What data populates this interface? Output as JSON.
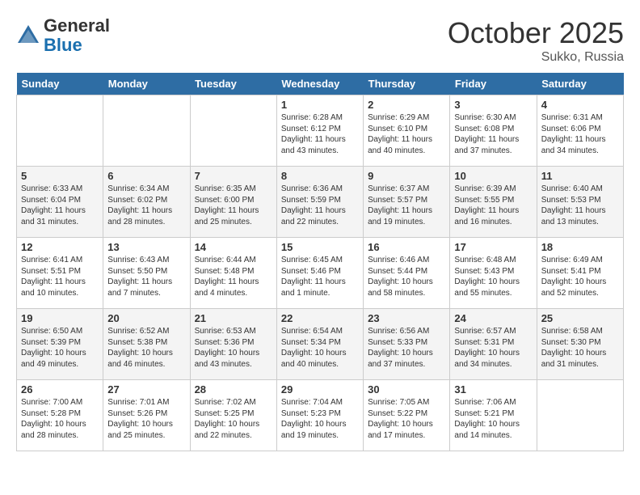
{
  "header": {
    "logo_line1": "General",
    "logo_line2": "Blue",
    "month": "October 2025",
    "location": "Sukko, Russia"
  },
  "days_of_week": [
    "Sunday",
    "Monday",
    "Tuesday",
    "Wednesday",
    "Thursday",
    "Friday",
    "Saturday"
  ],
  "weeks": [
    [
      {
        "day": "",
        "info": ""
      },
      {
        "day": "",
        "info": ""
      },
      {
        "day": "",
        "info": ""
      },
      {
        "day": "1",
        "info": "Sunrise: 6:28 AM\nSunset: 6:12 PM\nDaylight: 11 hours\nand 43 minutes."
      },
      {
        "day": "2",
        "info": "Sunrise: 6:29 AM\nSunset: 6:10 PM\nDaylight: 11 hours\nand 40 minutes."
      },
      {
        "day": "3",
        "info": "Sunrise: 6:30 AM\nSunset: 6:08 PM\nDaylight: 11 hours\nand 37 minutes."
      },
      {
        "day": "4",
        "info": "Sunrise: 6:31 AM\nSunset: 6:06 PM\nDaylight: 11 hours\nand 34 minutes."
      }
    ],
    [
      {
        "day": "5",
        "info": "Sunrise: 6:33 AM\nSunset: 6:04 PM\nDaylight: 11 hours\nand 31 minutes."
      },
      {
        "day": "6",
        "info": "Sunrise: 6:34 AM\nSunset: 6:02 PM\nDaylight: 11 hours\nand 28 minutes."
      },
      {
        "day": "7",
        "info": "Sunrise: 6:35 AM\nSunset: 6:00 PM\nDaylight: 11 hours\nand 25 minutes."
      },
      {
        "day": "8",
        "info": "Sunrise: 6:36 AM\nSunset: 5:59 PM\nDaylight: 11 hours\nand 22 minutes."
      },
      {
        "day": "9",
        "info": "Sunrise: 6:37 AM\nSunset: 5:57 PM\nDaylight: 11 hours\nand 19 minutes."
      },
      {
        "day": "10",
        "info": "Sunrise: 6:39 AM\nSunset: 5:55 PM\nDaylight: 11 hours\nand 16 minutes."
      },
      {
        "day": "11",
        "info": "Sunrise: 6:40 AM\nSunset: 5:53 PM\nDaylight: 11 hours\nand 13 minutes."
      }
    ],
    [
      {
        "day": "12",
        "info": "Sunrise: 6:41 AM\nSunset: 5:51 PM\nDaylight: 11 hours\nand 10 minutes."
      },
      {
        "day": "13",
        "info": "Sunrise: 6:43 AM\nSunset: 5:50 PM\nDaylight: 11 hours\nand 7 minutes."
      },
      {
        "day": "14",
        "info": "Sunrise: 6:44 AM\nSunset: 5:48 PM\nDaylight: 11 hours\nand 4 minutes."
      },
      {
        "day": "15",
        "info": "Sunrise: 6:45 AM\nSunset: 5:46 PM\nDaylight: 11 hours\nand 1 minute."
      },
      {
        "day": "16",
        "info": "Sunrise: 6:46 AM\nSunset: 5:44 PM\nDaylight: 10 hours\nand 58 minutes."
      },
      {
        "day": "17",
        "info": "Sunrise: 6:48 AM\nSunset: 5:43 PM\nDaylight: 10 hours\nand 55 minutes."
      },
      {
        "day": "18",
        "info": "Sunrise: 6:49 AM\nSunset: 5:41 PM\nDaylight: 10 hours\nand 52 minutes."
      }
    ],
    [
      {
        "day": "19",
        "info": "Sunrise: 6:50 AM\nSunset: 5:39 PM\nDaylight: 10 hours\nand 49 minutes."
      },
      {
        "day": "20",
        "info": "Sunrise: 6:52 AM\nSunset: 5:38 PM\nDaylight: 10 hours\nand 46 minutes."
      },
      {
        "day": "21",
        "info": "Sunrise: 6:53 AM\nSunset: 5:36 PM\nDaylight: 10 hours\nand 43 minutes."
      },
      {
        "day": "22",
        "info": "Sunrise: 6:54 AM\nSunset: 5:34 PM\nDaylight: 10 hours\nand 40 minutes."
      },
      {
        "day": "23",
        "info": "Sunrise: 6:56 AM\nSunset: 5:33 PM\nDaylight: 10 hours\nand 37 minutes."
      },
      {
        "day": "24",
        "info": "Sunrise: 6:57 AM\nSunset: 5:31 PM\nDaylight: 10 hours\nand 34 minutes."
      },
      {
        "day": "25",
        "info": "Sunrise: 6:58 AM\nSunset: 5:30 PM\nDaylight: 10 hours\nand 31 minutes."
      }
    ],
    [
      {
        "day": "26",
        "info": "Sunrise: 7:00 AM\nSunset: 5:28 PM\nDaylight: 10 hours\nand 28 minutes."
      },
      {
        "day": "27",
        "info": "Sunrise: 7:01 AM\nSunset: 5:26 PM\nDaylight: 10 hours\nand 25 minutes."
      },
      {
        "day": "28",
        "info": "Sunrise: 7:02 AM\nSunset: 5:25 PM\nDaylight: 10 hours\nand 22 minutes."
      },
      {
        "day": "29",
        "info": "Sunrise: 7:04 AM\nSunset: 5:23 PM\nDaylight: 10 hours\nand 19 minutes."
      },
      {
        "day": "30",
        "info": "Sunrise: 7:05 AM\nSunset: 5:22 PM\nDaylight: 10 hours\nand 17 minutes."
      },
      {
        "day": "31",
        "info": "Sunrise: 7:06 AM\nSunset: 5:21 PM\nDaylight: 10 hours\nand 14 minutes."
      },
      {
        "day": "",
        "info": ""
      }
    ]
  ]
}
